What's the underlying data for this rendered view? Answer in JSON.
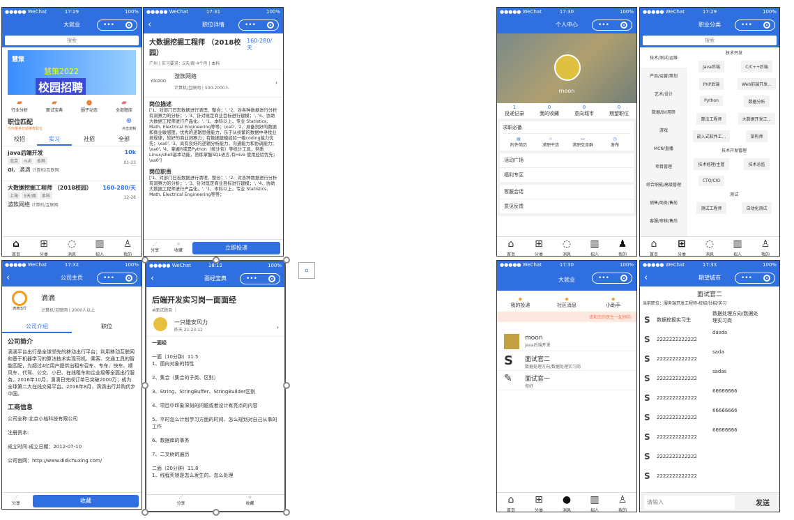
{
  "status": {
    "carrier": "●●●●● WeChat",
    "battery": "100%"
  },
  "p1": {
    "time": "17:29",
    "title": "大就业",
    "search": "搜索",
    "banner_brand": "慧策",
    "banner_year": "慧策2022",
    "banner_text": "校园招聘",
    "icons": [
      "行业分析",
      "面试宝典",
      "圈子动态",
      "全部题库"
    ],
    "section": "职位匹配",
    "section_sub": "为你量身打造推荐职位",
    "custom": "点击定制",
    "tabs": [
      "校招",
      "实习",
      "社招",
      "全部"
    ],
    "jobs": [
      {
        "title": "java后端开发",
        "salary": "10k",
        "tags": [
          "北京",
          "null",
          "本科"
        ],
        "date": "01-23",
        "company": "滴滴",
        "industry": "计算机/互联网"
      },
      {
        "title": "大数据挖掘工程师 （2018校园）",
        "salary": "160-280/天",
        "tags": [
          "上海",
          "5天/周",
          "本科"
        ],
        "date": "12-28",
        "company": "游族网络",
        "industry": "计算机/互联网"
      }
    ],
    "nav": [
      "首页",
      "分类",
      "消息",
      "招人",
      "我的"
    ]
  },
  "p2": {
    "time": "17:31",
    "title": "职位详情",
    "job_title": "大数据挖掘工程师 （2018校园）",
    "salary": "160-280/天",
    "meta": "广州 | 实习要求：5天/周 4个月 | 本科",
    "company": "游族网络",
    "industry": "计算机/互联网 | 500-2000人",
    "desc_h": "岗位描述",
    "desc": "['1、对部门日志数据进行清理、整合；', '2、对各种数据进行分析有洞察力的分析；', '3、针对既定商业目标进行建模；', '4、协助大数据工程师进行产品化。', '1、本科以上，专业 Statistics, Math, Electrical Engineering等等；\\xa0', '2、具备良好的数据和商业敏感度，优秀的逻辑思维能力，乐于从纷繁的数据中寻找业务规律，较好的商业洞察力；有数据建模经验一级coding能力优先；\\xa0', '3、具有良好的逻辑分析能力，沟通能力和协调能力；\\xa0', '4、掌握R或是Python（统计包）等统计工具，熟悉Linux/shell基本功能，熟练掌握SQL语言,有Hive 使用经验优先；\\xa0']",
    "duty_h": "岗位职责",
    "duty": "['1、对部门日志数据进行清理、整合；', '2、对各种数据进行分析有洞察力的分析；', '3、针对既定商业目标进行建模；', '4、协助大数据工程师进行产品化。', '1、本科以上，专业 Statistics, Math, Electrical Engineering等等；",
    "share": "分享",
    "fav": "收藏",
    "apply": "立即投递"
  },
  "p3": {
    "time": "17:30",
    "title": "个人中心",
    "name": "moon",
    "stats": [
      {
        "n": "1",
        "l": "投递记录"
      },
      {
        "n": "0",
        "l": "我的收藏"
      },
      {
        "n": "0",
        "l": "意向城市"
      },
      {
        "n": "0",
        "l": "期望职位"
      }
    ],
    "must": "求职必备",
    "tools": [
      "附件简历",
      "求职干货",
      "求职交流群",
      "发布"
    ],
    "items": [
      "活动广场",
      "福利专区",
      "客服会话",
      "意见反馈"
    ]
  },
  "p4": {
    "time": "17:29",
    "title": "职业分类",
    "search": "搜索",
    "left": [
      "技术/测试/运维",
      "产品/运营/策划",
      "艺术/设计",
      "数据/BI/用研",
      "游戏",
      "MCN/直播",
      "项目管理",
      "综合职能/高级管理",
      "销售/商务/售前",
      "客服/审核/售后"
    ],
    "g1": "技术开发",
    "g1items": [
      "Java后端",
      "C/C++后端",
      "PHP后端",
      "Web前端开发...",
      "Python",
      "数据分析",
      "算法工程师",
      "大数据开发工...",
      "嵌入式软件工...",
      "架构师"
    ],
    "g2": "技术开发管理",
    "g2items": [
      "技术经理/主管",
      "技术总监",
      "CTO/CIO"
    ],
    "g3": "测试",
    "g3items": [
      "测试工程师",
      "自动化测试"
    ]
  },
  "p5": {
    "time": "17:32",
    "title": "公司主页",
    "company": "滴滴",
    "logo_text": "滴滴出行",
    "industry": "计算机/互联网 | 2000人以上",
    "tabs": [
      "公司介绍",
      "职位"
    ],
    "intro_h": "公司简介",
    "intro": "滴滴平台出行是全球领先的移动出行平台；利用移动互联网和基于机器学习的算法技术实现司机、乘客、交通工具的智能匹配，为超过4亿用户提供出租车召车、专车、快车、顺风车、代驾、公交、小巴、在线租车和企业级等全面出行服务。2016年10月，滴滴日完成订单已突破2000万；成为全球第二大在线交易平台。2016年8月，滴滴出行并购优步中国。",
    "biz_h": "工商信息",
    "biz": [
      "公司全称:北京小桔科技有限公司",
      "注册资本:",
      "成立时间:成立日期：2012-07-10",
      "公司官网：http://www.didichuxing.com/"
    ],
    "share": "分享",
    "fav": "收藏"
  },
  "p6": {
    "time": "18:12",
    "title": "面经宝典",
    "h": "后端开发实习岗一面面经",
    "tag": "#面试题目 ｜",
    "author": "一只雄安风力",
    "atime": "昨天 21:23:12",
    "s1": "一面经",
    "lines": [
      "一面（10分钟）11.5",
      "1、面向对象的特性",
      "2、集合（集合的子类、区别）",
      "3、String、StringBuffer、StringBuilder区别",
      "4、项目中印象深刻的问题或者设计有亮点的内容",
      "5、平时怎么计划学习方面的时间、怎么规划对自己从事的工作",
      "6、数据库的事务",
      "7、二叉树的遍历",
      "二面（20分钟）11.8",
      "1、线程死锁是怎么发生的、怎么处理"
    ],
    "share": "分享",
    "fav": "收藏"
  },
  "p7": {
    "time": "17:30",
    "title": "大就业",
    "tabs": [
      "我的投递",
      "社区消息",
      "小助手"
    ],
    "banner": "请和您的医生一起预防·",
    "msgs": [
      {
        "n": "moon",
        "s": "java后端开发"
      },
      {
        "n": "面试官二",
        "s": "数据处理方向/数据处理实习岗"
      },
      {
        "n": "面试官一",
        "s": "你好"
      }
    ]
  },
  "p8": {
    "time": "17:33",
    "title": "期望城市",
    "h": "面试官二",
    "sub": "当前职位：服务端开发工程师-校招/社招/实习",
    "left": [
      "数据挖掘实习生",
      "2222222222222",
      "2222222222222",
      "2222222222222",
      "2222222222222",
      "2222222222222",
      "2222222222222",
      "2222222222222",
      "2222222222222"
    ],
    "right": [
      "数据处理方向/数据处理实习岗",
      "dasda",
      "sada",
      "sadas",
      "66666666",
      "66666666",
      "66666666"
    ],
    "input": "请输入",
    "send": "发送"
  }
}
